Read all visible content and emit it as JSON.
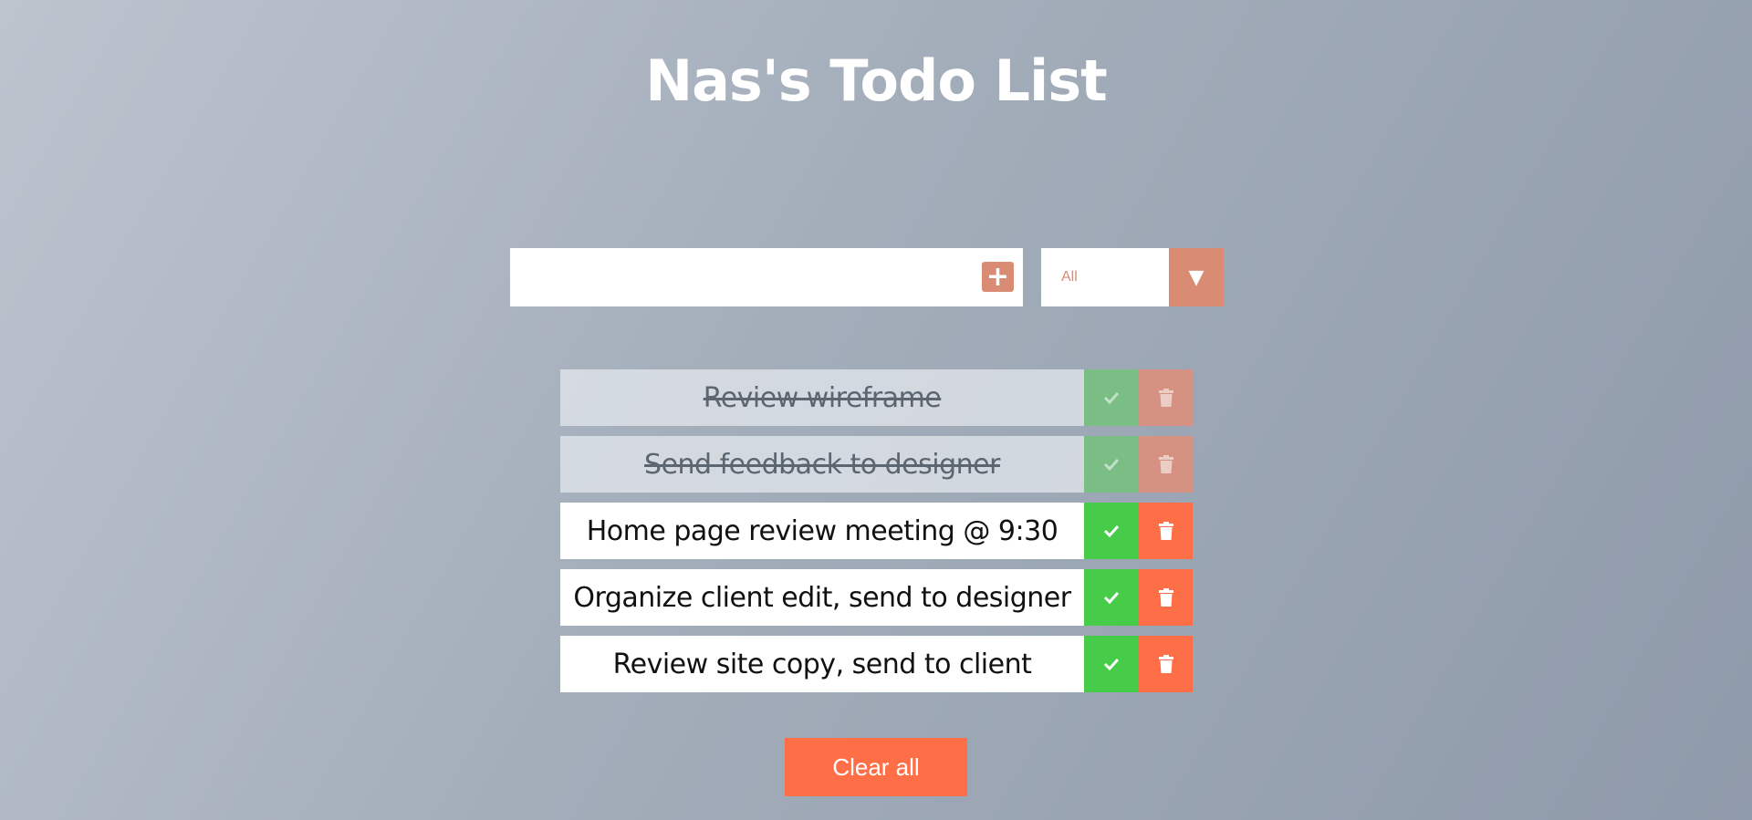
{
  "header": {
    "title": "Nas's Todo List"
  },
  "form": {
    "input_value": "",
    "add_icon": "plus-icon",
    "filter": {
      "selected": "All",
      "arrow_icon": "caret-down-icon"
    }
  },
  "todos": [
    {
      "text": "Review wireframe",
      "completed": true
    },
    {
      "text": "Send feedback to designer",
      "completed": true
    },
    {
      "text": "Home page review meeting @ 9:30",
      "completed": false
    },
    {
      "text": "Organize client edit, send to designer",
      "completed": false
    },
    {
      "text": "Review site copy, send to client",
      "completed": false
    }
  ],
  "actions": {
    "clear_all_label": "Clear all"
  },
  "colors": {
    "accent": "#d98b73",
    "complete": "#46cc48",
    "delete": "#ff6f47"
  }
}
